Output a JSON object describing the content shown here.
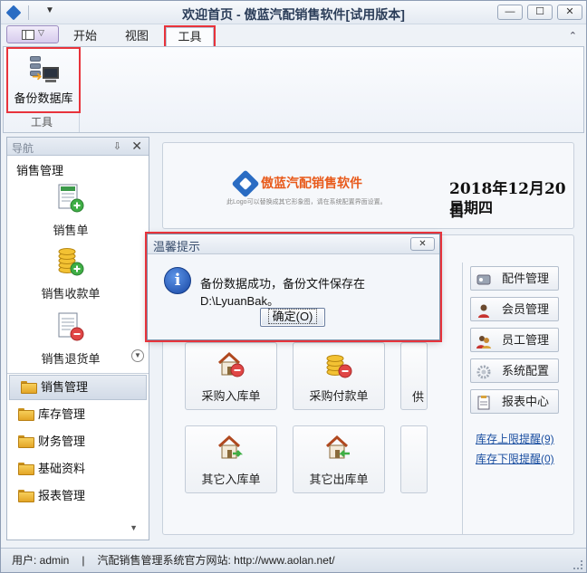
{
  "window": {
    "title": "欢迎首页 - 傲蓝汽配销售软件[试用版本]",
    "controls": {
      "minimize": "—",
      "maximize": "☐",
      "close": "✕"
    },
    "qat_arrow": "▼"
  },
  "ribbon": {
    "tabs": [
      {
        "label": "开始",
        "active": false
      },
      {
        "label": "视图",
        "active": false
      },
      {
        "label": "工具",
        "active": true
      }
    ],
    "app_menu_caret": "▽",
    "collapse": "⌃",
    "group_label": "工具",
    "backup_button": "备份数据库"
  },
  "nav": {
    "title": "导航",
    "pin": "⇩",
    "close": "✕",
    "section": "销售管理",
    "items": [
      {
        "label": "销售单",
        "icon": "sales-order-icon"
      },
      {
        "label": "销售收款单",
        "icon": "sales-receipt-icon"
      },
      {
        "label": "销售退货单",
        "icon": "sales-return-icon"
      }
    ],
    "scroll": "▼",
    "groups": [
      {
        "label": "销售管理",
        "active": true
      },
      {
        "label": "库存管理",
        "active": false
      },
      {
        "label": "财务管理",
        "active": false
      },
      {
        "label": "基础资料",
        "active": false
      },
      {
        "label": "报表管理",
        "active": false
      }
    ],
    "more": "▼"
  },
  "header": {
    "logo_text": "傲蓝汽配销售软件",
    "logo_sub": "此Logo可以替换成其它形象图，请在系统配置界面设置。",
    "date": "2018年12月20日",
    "weekday": "星期四"
  },
  "tiles": [
    {
      "label": "采购入库单",
      "icon": "purchase-in-icon"
    },
    {
      "label": "采购付款单",
      "icon": "purchase-payment-icon"
    },
    {
      "label": "供",
      "icon": "supplier-icon"
    },
    {
      "label": "其它入库单",
      "icon": "other-in-icon"
    },
    {
      "label": "其它出库单",
      "icon": "other-out-icon"
    }
  ],
  "side_buttons": [
    {
      "label": "配件管理",
      "icon": "parts-icon"
    },
    {
      "label": "会员管理",
      "icon": "member-icon"
    },
    {
      "label": "员工管理",
      "icon": "staff-icon"
    },
    {
      "label": "系统配置",
      "icon": "settings-icon"
    },
    {
      "label": "报表中心",
      "icon": "report-icon"
    }
  ],
  "links": [
    {
      "label": "库存上限提醒(9)"
    },
    {
      "label": "库存下限提醒(0)"
    }
  ],
  "status": {
    "user": "用户: admin",
    "separator": "|",
    "site": "汽配销售管理系统官方网站: http://www.aolan.net/"
  },
  "dialog": {
    "title": "温馨提示",
    "close": "✕",
    "info": "i",
    "message": "备份数据成功，备份文件保存在D:\\LyuanBak。",
    "ok": "确定(O)"
  }
}
